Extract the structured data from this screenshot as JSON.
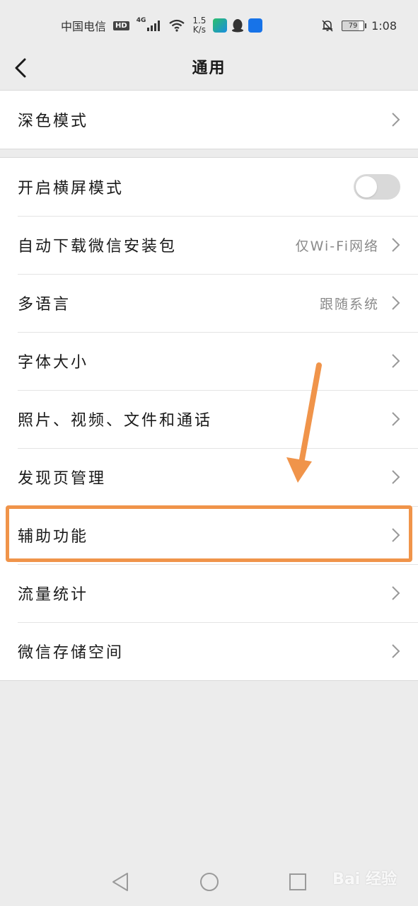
{
  "status_bar": {
    "carrier": "中国电信",
    "hd": "HD",
    "network": "4G",
    "speed_value": "1.5",
    "speed_unit": "K/s",
    "battery": "79",
    "time": "1:08"
  },
  "header": {
    "title": "通用"
  },
  "groups": [
    {
      "items": [
        {
          "label": "深色模式"
        }
      ]
    },
    {
      "items": [
        {
          "label": "开启横屏模式",
          "toggle_on": false
        },
        {
          "label": "自动下载微信安装包",
          "value": "仅Wi-Fi网络"
        },
        {
          "label": "多语言",
          "value": "跟随系统"
        },
        {
          "label": "字体大小"
        },
        {
          "label": "照片、视频、文件和通话"
        },
        {
          "label": "发现页管理"
        },
        {
          "label": "辅助功能"
        },
        {
          "label": "流量统计"
        },
        {
          "label": "微信存储空间"
        }
      ]
    }
  ],
  "annotation": {
    "highlighted_item": "辅助功能",
    "color": "#f0944a"
  },
  "watermark": "Bai 经验",
  "nav_icons": [
    "back-triangle-icon",
    "home-circle-icon",
    "recents-square-icon"
  ]
}
